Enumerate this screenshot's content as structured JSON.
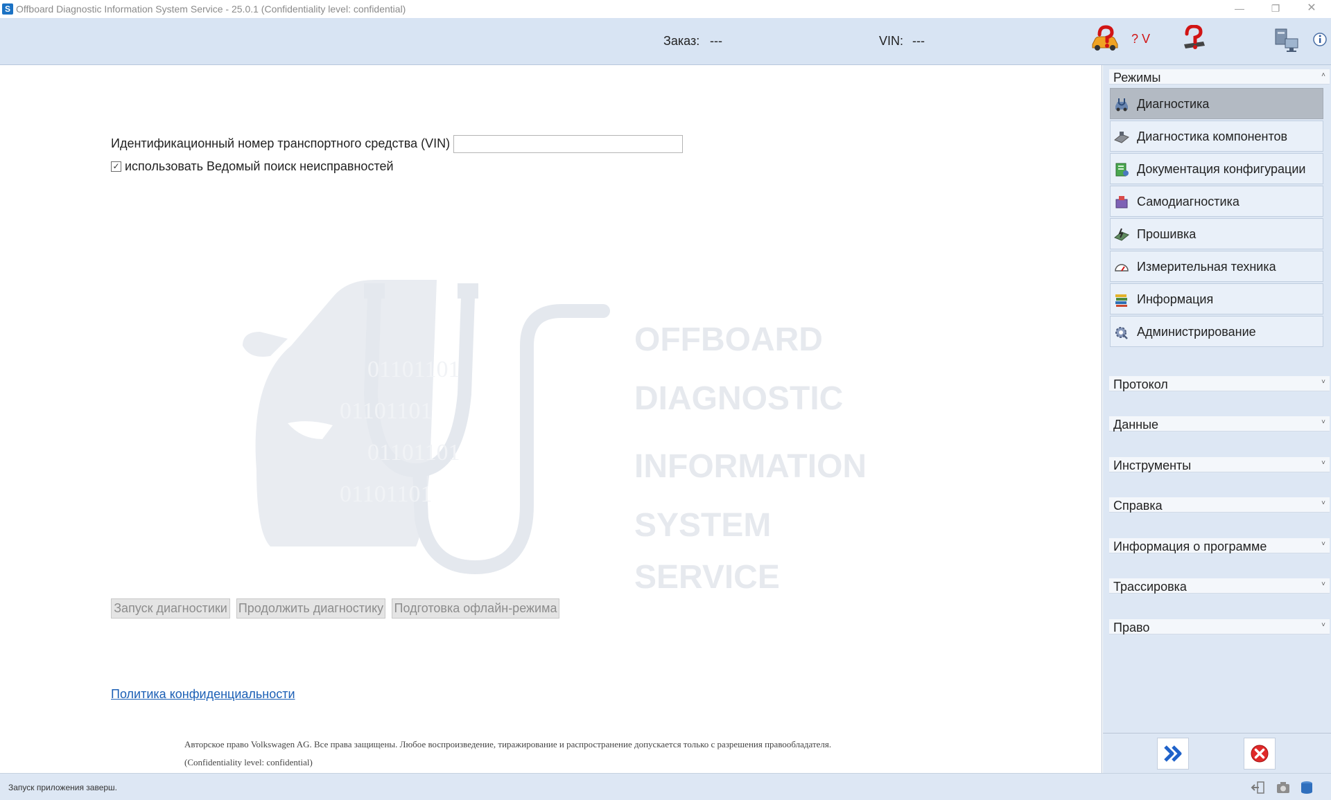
{
  "window": {
    "title": "Offboard Diagnostic Information System Service - 25.0.1 (Confidentiality level: confidential)",
    "app_icon_letter": "S",
    "minimize_glyph": "—",
    "maximize_glyph": "❐",
    "close_glyph": "✕"
  },
  "header": {
    "order_label": "Заказ:",
    "order_value": "---",
    "vin_label": "VIN:",
    "vin_value": "---",
    "voltage_text": "? V",
    "icons": [
      "car-help-icon",
      "question-help-icon",
      "network-icon",
      "info-icon"
    ]
  },
  "main": {
    "vin_field_label": "Идентификационный номер транспортного средства (VIN)",
    "vin_field_value": "",
    "guided_checkbox_label": "использовать Ведомый поиск неисправностей",
    "guided_checkbox_checked": true,
    "checkmark": "✓",
    "buttons": {
      "start": "Запуск диагностики",
      "continue": "Продолжить диагностику",
      "offline": "Подготовка офлайн-режима"
    },
    "privacy_link": "Политика конфиденциальности",
    "copyright_line1": "Авторское право Volkswagen AG. Все права защищены. Любое воспроизведение, тиражирование и распространение допускается только с разрешения правообладателя.",
    "copyright_line2": "(Confidentiality level: confidential)",
    "watermark": {
      "words": [
        "OFFBOARD",
        "DIAGNOSTIC",
        "INFORMATION",
        "SYSTEM",
        "SERVICE"
      ],
      "binary": [
        "01101101",
        "01101101",
        "01101101",
        "01101101"
      ]
    }
  },
  "sidebar": {
    "modes_title": "Режимы",
    "modes": [
      {
        "label": "Диагностика",
        "icon": "stethoscope-icon",
        "active": true
      },
      {
        "label": "Диагностика компонентов",
        "icon": "component-diagnosis-icon",
        "active": false
      },
      {
        "label": "Документация конфигурации",
        "icon": "configuration-docs-icon",
        "active": false
      },
      {
        "label": "Самодиагностика",
        "icon": "self-diagnosis-icon",
        "active": false
      },
      {
        "label": "Прошивка",
        "icon": "flashing-icon",
        "active": false
      },
      {
        "label": "Измерительная техника",
        "icon": "gauge-icon",
        "active": false
      },
      {
        "label": "Информация",
        "icon": "books-icon",
        "active": false
      },
      {
        "label": "Администрирование",
        "icon": "admin-gear-icon",
        "active": false
      }
    ],
    "sections": [
      {
        "label": "Протокол"
      },
      {
        "label": "Данные"
      },
      {
        "label": "Инструменты"
      },
      {
        "label": "Справка"
      },
      {
        "label": "Информация о программе"
      },
      {
        "label": "Трассировка"
      },
      {
        "label": "Право"
      }
    ],
    "chevron_up": "˄",
    "chevron_down": "˅"
  },
  "status": {
    "text": "Запуск приложения заверш."
  },
  "colors": {
    "header_bg": "#d8e4f3",
    "panel_bg": "#dde7f4",
    "active_mode": "#b3bac3",
    "link": "#1b5fb5",
    "voltage_red": "#d11414"
  }
}
